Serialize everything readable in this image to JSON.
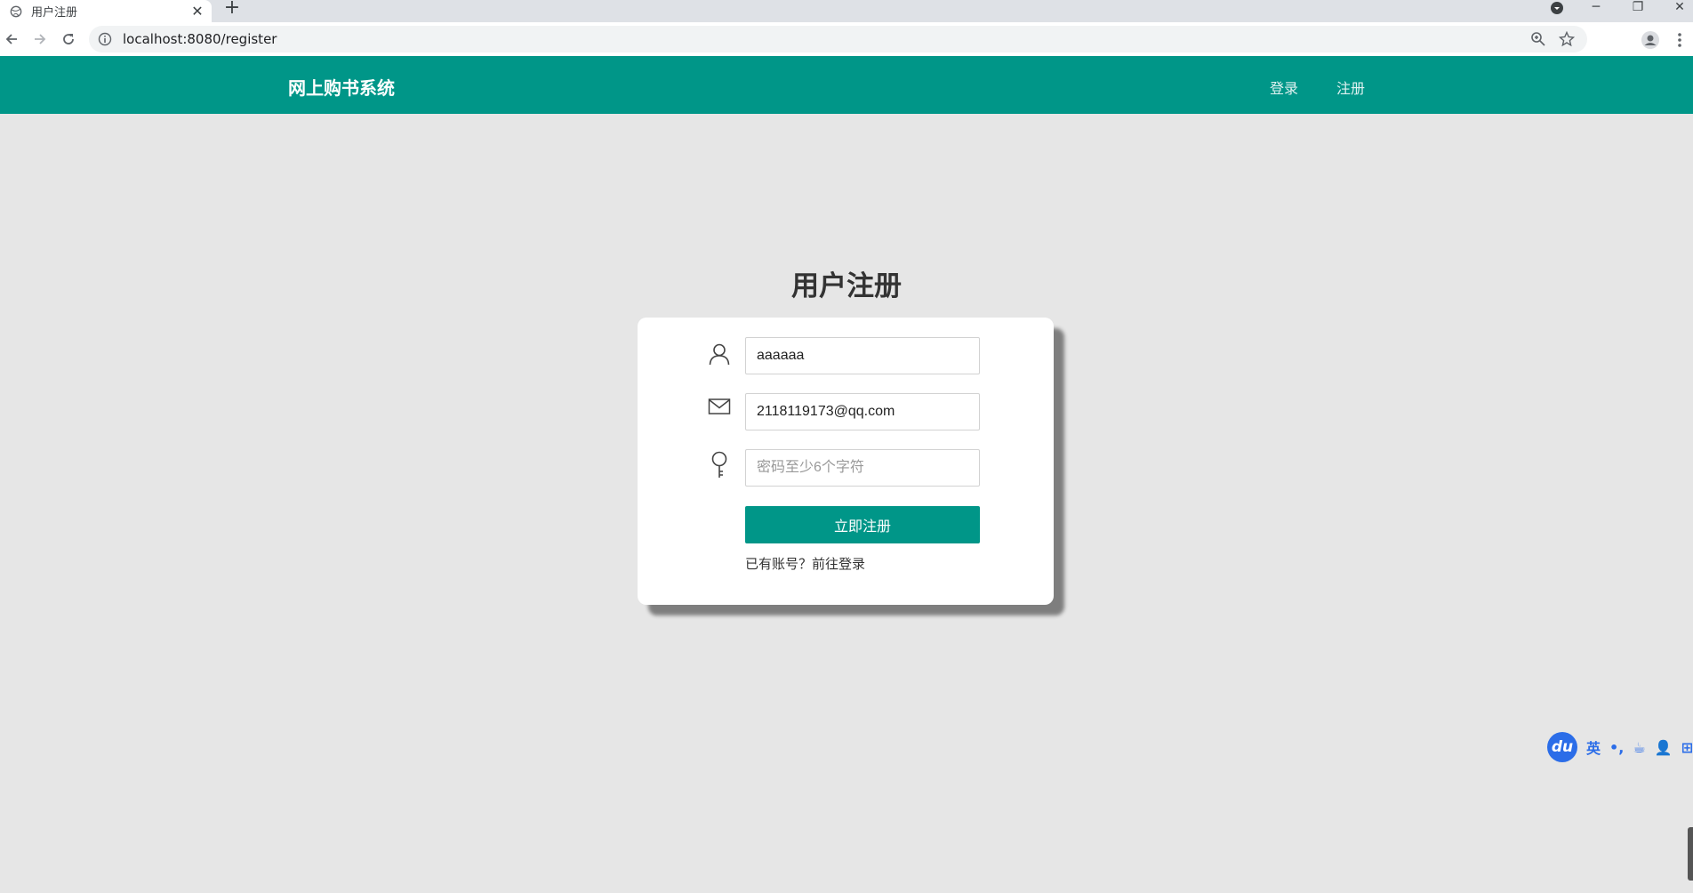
{
  "browser": {
    "tab_title": "用户注册",
    "url": "localhost:8080/register"
  },
  "header": {
    "brand": "网上购书系统",
    "nav": {
      "login": "登录",
      "register": "注册"
    }
  },
  "form": {
    "title": "用户注册",
    "username_value": "aaaaaa",
    "email_value": "2118119173@qq.com",
    "password_value": "",
    "password_placeholder": "密码至少6个字符",
    "submit_label": "立即注册",
    "login_link": "已有账号？前往登录"
  },
  "ime": {
    "logo": "du",
    "lang": "英"
  },
  "colors": {
    "accent": "#009688",
    "page_bg": "#e6e6e6"
  },
  "icons": [
    "globe-icon",
    "close-icon",
    "plus-icon",
    "back-icon",
    "forward-icon",
    "reload-icon",
    "info-icon",
    "zoom-icon",
    "star-icon",
    "profile-icon",
    "menu-icon",
    "user-icon",
    "mail-icon",
    "key-icon"
  ]
}
